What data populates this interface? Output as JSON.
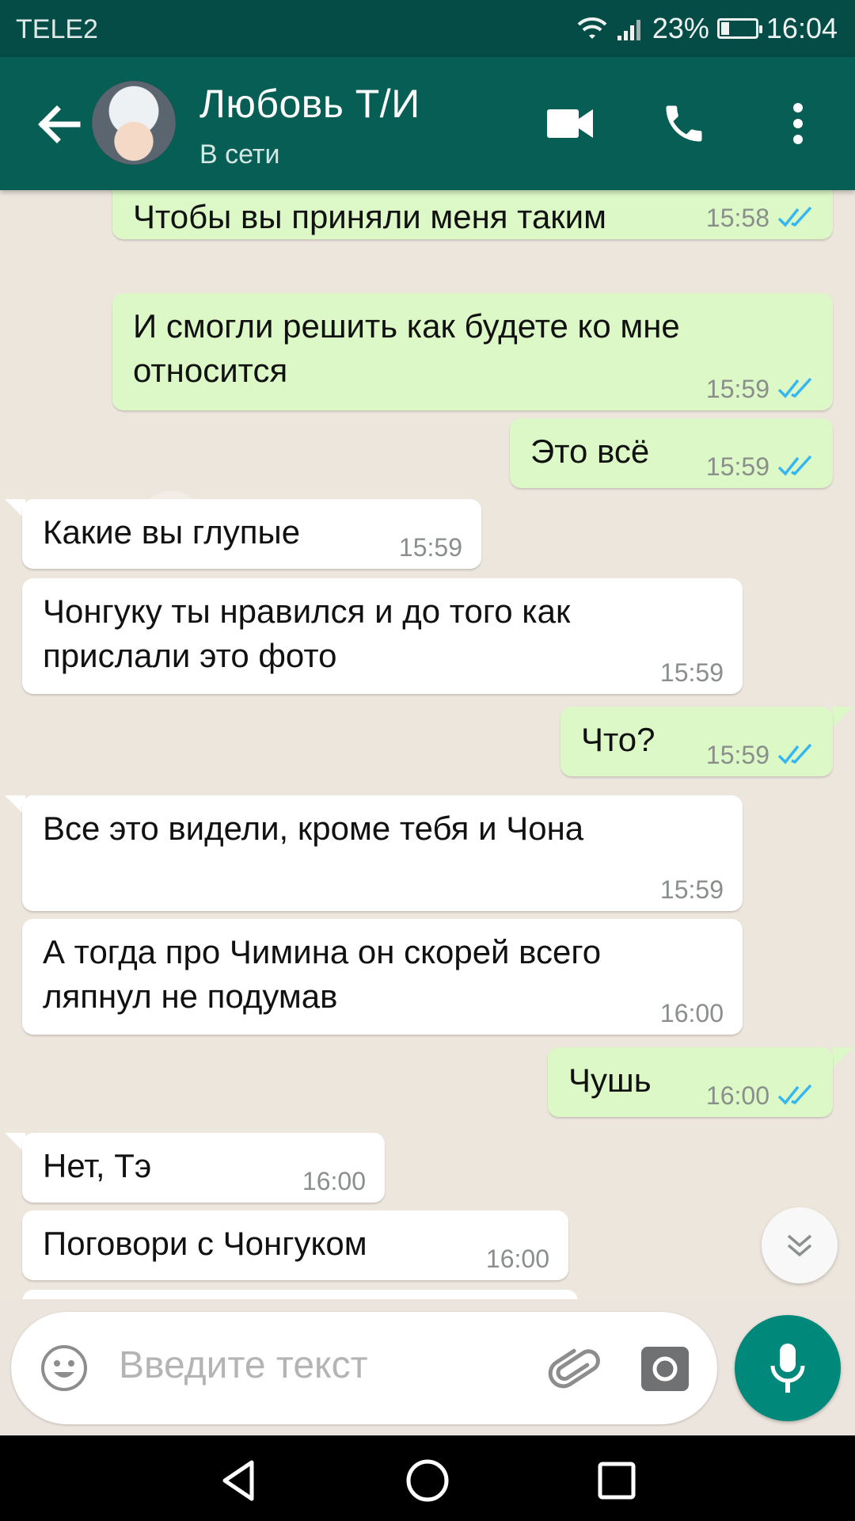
{
  "status_bar": {
    "carrier": "TELE2",
    "battery": "23%",
    "battery_level": 0.23,
    "time": "16:04"
  },
  "header": {
    "contact_name": "Любовь Т/И",
    "contact_status": "В сети"
  },
  "messages": [
    {
      "dir": "out",
      "lines": [
        "Чтобы вы приняли меня таким"
      ],
      "time": "15:58",
      "read": true
    },
    {
      "dir": "out",
      "lines": [
        "И смогли решить как будете ко мне",
        "относится"
      ],
      "time": "15:59",
      "read": true
    },
    {
      "dir": "out",
      "lines": [
        "Это всё"
      ],
      "time": "15:59",
      "read": true
    },
    {
      "dir": "in",
      "lines": [
        "Какие вы глупые"
      ],
      "time": "15:59"
    },
    {
      "dir": "in",
      "lines": [
        "Чонгуку ты нравился и до того как",
        "прислали это фото"
      ],
      "time": "15:59"
    },
    {
      "dir": "out",
      "lines": [
        "Что?"
      ],
      "time": "15:59",
      "read": true
    },
    {
      "dir": "in",
      "lines": [
        "Все это видели, кроме тебя и Чона"
      ],
      "time": "15:59"
    },
    {
      "dir": "in",
      "lines": [
        "А тогда про Чимина он скорей всего",
        "ляпнул не подумав"
      ],
      "time": "16:00"
    },
    {
      "dir": "out",
      "lines": [
        "Чушь"
      ],
      "time": "16:00",
      "read": true
    },
    {
      "dir": "in",
      "lines": [
        "Нет, Тэ"
      ],
      "time": "16:00"
    },
    {
      "dir": "in",
      "lines": [
        "Поговори с Чонгуком"
      ],
      "time": "16:00"
    }
  ],
  "input": {
    "placeholder": "Введите текст"
  },
  "icons": {
    "back": "arrow-left",
    "video": "video-camera",
    "call": "phone",
    "menu": "more-vertical",
    "emoji": "smiley",
    "attach": "paperclip",
    "camera": "camera",
    "mic": "microphone",
    "scroll": "double-chevron-down"
  },
  "colors": {
    "header": "#075e54",
    "status_bar": "#064c46",
    "outgoing_bubble": "#dcf8c6",
    "incoming_bubble": "#ffffff",
    "read_ticks": "#34b7f1",
    "mic_button": "#00897b"
  }
}
